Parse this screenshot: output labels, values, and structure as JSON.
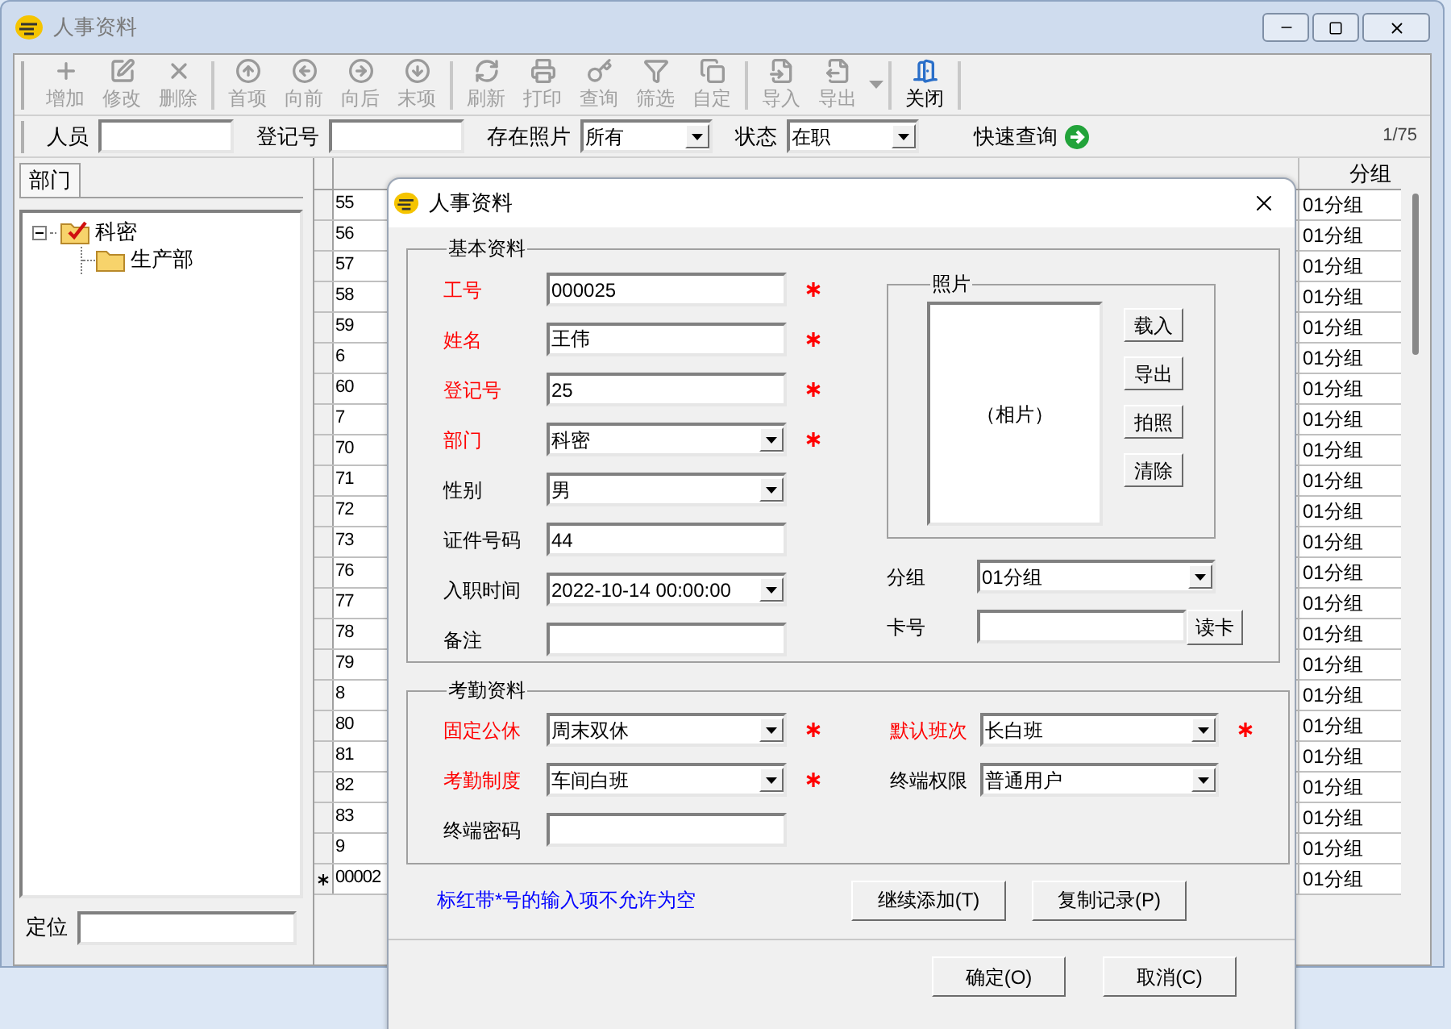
{
  "window": {
    "title": "人事资料"
  },
  "toolbar": [
    [
      {
        "label": "增加",
        "disabled": true
      },
      {
        "label": "修改",
        "disabled": true
      },
      {
        "label": "删除",
        "disabled": true
      }
    ],
    [
      {
        "label": "首项",
        "disabled": true
      },
      {
        "label": "向前",
        "disabled": true
      },
      {
        "label": "向后",
        "disabled": true
      },
      {
        "label": "末项",
        "disabled": true
      }
    ],
    [
      {
        "label": "刷新",
        "disabled": true
      },
      {
        "label": "打印",
        "disabled": true
      },
      {
        "label": "查询",
        "disabled": true
      },
      {
        "label": "筛选",
        "disabled": true
      },
      {
        "label": "自定",
        "disabled": true
      }
    ],
    [
      {
        "label": "导入",
        "disabled": true
      },
      {
        "label": "导出",
        "disabled": true,
        "has_menu": true
      }
    ],
    [
      {
        "label": "关闭",
        "disabled": false
      }
    ]
  ],
  "filter_bar": {
    "fields": [
      {
        "kind": "input",
        "label": "人员"
      },
      {
        "kind": "input",
        "label": "登记号"
      },
      {
        "kind": "select",
        "label": "存在照片",
        "value": "所有"
      },
      {
        "kind": "select",
        "label": "状态",
        "value": "在职"
      }
    ],
    "quick_search": "快速查询",
    "record_count": "1/75"
  },
  "sidebar": {
    "tab": "部门",
    "tree": [
      {
        "label": "科密",
        "checked": true,
        "expanded": true,
        "children": [
          {
            "label": "生产部",
            "checked": false
          }
        ]
      }
    ],
    "locate_label": "定位"
  },
  "grid": {
    "columns": [
      {
        "label": "分组"
      }
    ],
    "rows": [
      {
        "column_1": "55",
        "group": "01分组",
        "new": false
      },
      {
        "column_1": "56",
        "group": "01分组",
        "new": false
      },
      {
        "column_1": "57",
        "group": "01分组",
        "new": false
      },
      {
        "column_1": "58",
        "group": "01分组",
        "new": false
      },
      {
        "column_1": "59",
        "group": "01分组",
        "new": false
      },
      {
        "column_1": "6",
        "group": "01分组",
        "new": false
      },
      {
        "column_1": "60",
        "group": "01分组",
        "new": false
      },
      {
        "column_1": "7",
        "group": "01分组",
        "new": false
      },
      {
        "column_1": "70",
        "group": "01分组",
        "new": false
      },
      {
        "column_1": "71",
        "group": "01分组",
        "new": false
      },
      {
        "column_1": "72",
        "group": "01分组",
        "new": false
      },
      {
        "column_1": "73",
        "group": "01分组",
        "new": false
      },
      {
        "column_1": "76",
        "group": "01分组",
        "new": false
      },
      {
        "column_1": "77",
        "group": "01分组",
        "new": false
      },
      {
        "column_1": "78",
        "group": "01分组",
        "new": false
      },
      {
        "column_1": "79",
        "group": "01分组",
        "new": false
      },
      {
        "column_1": "8",
        "group": "01分组",
        "new": false
      },
      {
        "column_1": "80",
        "group": "01分组",
        "new": false
      },
      {
        "column_1": "81",
        "group": "01分组",
        "new": false
      },
      {
        "column_1": "82",
        "group": "01分组",
        "new": false
      },
      {
        "column_1": "83",
        "group": "01分组",
        "new": false
      },
      {
        "column_1": "9",
        "group": "01分组",
        "new": false
      },
      {
        "column_1": "00002",
        "group": "01分组",
        "new": true
      }
    ]
  },
  "dialog": {
    "title": "人事资料",
    "basic": {
      "legend": "基本资料",
      "fields": [
        {
          "label": "工号",
          "kind": "input",
          "value": "000025",
          "required": true
        },
        {
          "label": "姓名",
          "kind": "input",
          "value": "王伟",
          "required": true
        },
        {
          "label": "登记号",
          "kind": "input",
          "value": "25",
          "required": true
        },
        {
          "label": "部门",
          "kind": "select",
          "value": "科密",
          "required": true
        },
        {
          "label": "性别",
          "kind": "select",
          "value": "男",
          "required": false
        },
        {
          "label": "证件号码",
          "kind": "input",
          "value": "44",
          "required": false
        },
        {
          "label": "入职时间",
          "kind": "select",
          "value": "2022-10-14 00:00:00",
          "required": false
        },
        {
          "label": "备注",
          "kind": "input",
          "required": false
        }
      ],
      "photo": {
        "legend": "照片",
        "placeholder": "（相片）",
        "buttons": [
          "载入",
          "导出",
          "拍照",
          "清除"
        ]
      },
      "group_field": {
        "label": "分组",
        "value": "01分组"
      },
      "card_field": {
        "label": "卡号",
        "button": "读卡"
      }
    },
    "attendance": {
      "legend": "考勤资料",
      "fields": [
        {
          "label": "固定公休",
          "kind": "select",
          "value": "周末双休",
          "required": true
        },
        {
          "label": "默认班次",
          "kind": "select",
          "value": "长白班",
          "required": true
        },
        {
          "label": "考勤制度",
          "kind": "select",
          "value": "车间白班",
          "required": true
        },
        {
          "label": "终端权限",
          "kind": "select",
          "value": "普通用户",
          "required": false
        },
        {
          "label": "终端密码",
          "kind": "input",
          "required": false
        }
      ]
    },
    "note": "标红带*号的输入项不允许为空",
    "action_buttons": [
      "继续添加(T)",
      "复制记录(P)"
    ],
    "footer_buttons": [
      "确定(O)",
      "取消(C)"
    ]
  }
}
